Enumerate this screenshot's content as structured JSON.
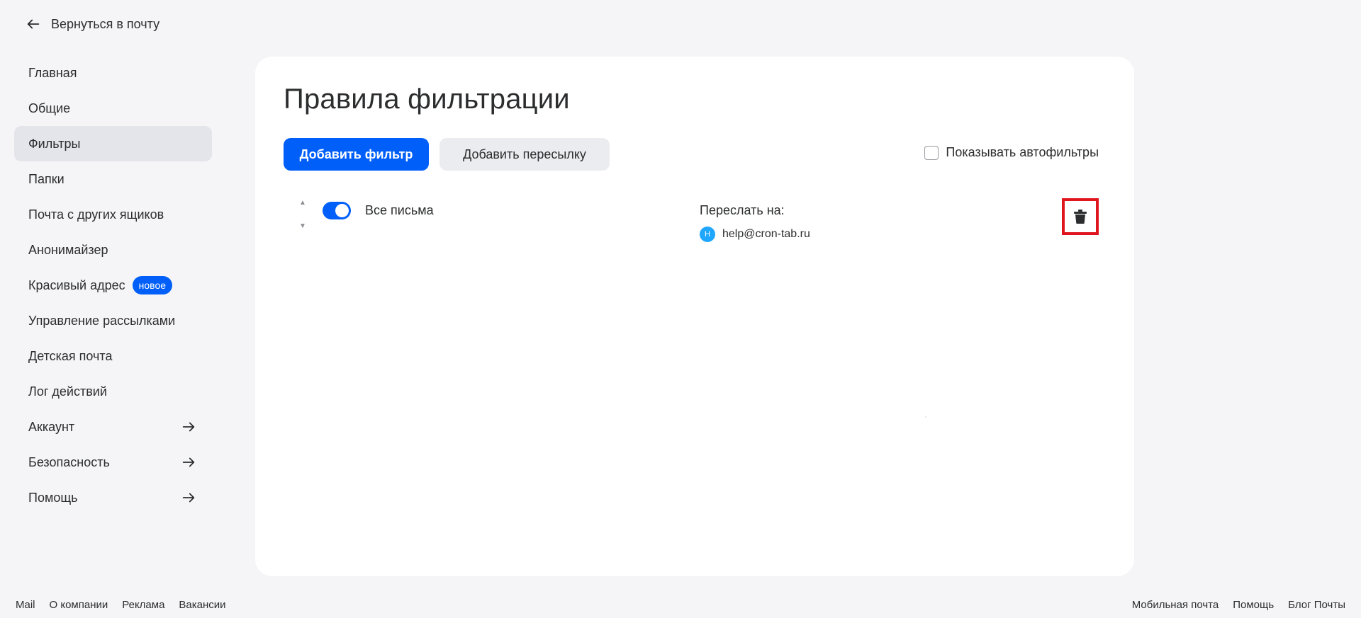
{
  "back_link": {
    "label": "Вернуться в почту",
    "icon": "arrow-left-icon"
  },
  "sidebar": {
    "items": [
      {
        "label": "Главная"
      },
      {
        "label": "Общие"
      },
      {
        "label": "Фильтры",
        "active": true
      },
      {
        "label": "Папки"
      },
      {
        "label": "Почта с других ящиков"
      },
      {
        "label": "Анонимайзер"
      },
      {
        "label": "Красивый адрес",
        "badge": "новое"
      },
      {
        "label": "Управление рассылками"
      },
      {
        "label": "Детская почта"
      },
      {
        "label": "Лог действий"
      },
      {
        "label": "Аккаунт",
        "icon": "arrow-right-icon"
      },
      {
        "label": "Безопасность",
        "icon": "arrow-right-icon"
      },
      {
        "label": "Помощь",
        "icon": "arrow-right-icon"
      }
    ]
  },
  "main": {
    "title": "Правила фильтрации",
    "add_filter_label": "Добавить фильтр",
    "add_forward_label": "Добавить пересылку",
    "show_autofilters_label": "Показывать автофильтры",
    "show_autofilters_checked": false,
    "filters": [
      {
        "enabled": true,
        "name": "Все письма",
        "action_label": "Переслать на:",
        "avatar_letter": "H",
        "target": "help@cron-tab.ru"
      }
    ]
  },
  "footer": {
    "left_links": [
      "Mail",
      "О компании",
      "Реклама",
      "Вакансии"
    ],
    "right_links": [
      "Мобильная почта",
      "Помощь",
      "Блог Почты"
    ]
  },
  "colors": {
    "accent": "#005ff9",
    "background": "#f5f5f7",
    "panel": "#ffffff",
    "highlight_border": "#e0161f",
    "avatar": "#1ea7fd"
  }
}
